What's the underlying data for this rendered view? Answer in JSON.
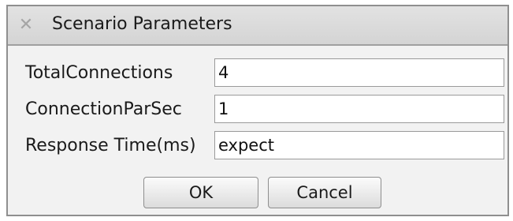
{
  "window": {
    "title": "Scenario Parameters",
    "close_icon": "close-icon"
  },
  "fields": [
    {
      "label": "TotalConnections",
      "value": "4"
    },
    {
      "label": "ConnectionParSec",
      "value": "1"
    },
    {
      "label": "Response Time(ms)",
      "value": "expect"
    }
  ],
  "buttons": {
    "ok_label": "OK",
    "cancel_label": "Cancel"
  }
}
